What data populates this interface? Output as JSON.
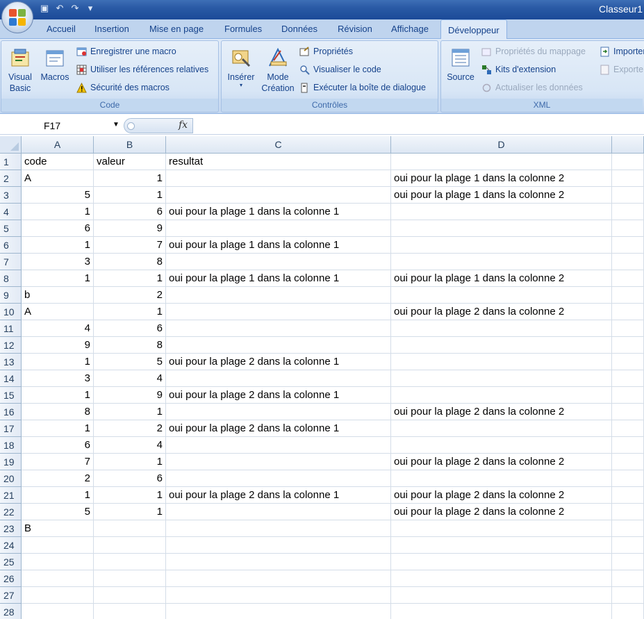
{
  "window": {
    "title": "Classeur1"
  },
  "tabs": [
    "Accueil",
    "Insertion",
    "Mise en page",
    "Formules",
    "Données",
    "Révision",
    "Affichage",
    "Développeur"
  ],
  "active_tab": "Développeur",
  "ribbon": {
    "code": {
      "label": "Code",
      "visual_basic": "Visual\nBasic",
      "macros": "Macros",
      "record_macro": "Enregistrer une macro",
      "relative_refs": "Utiliser les références relatives",
      "macro_security": "Sécurité des macros"
    },
    "controls": {
      "label": "Contrôles",
      "insert": "Insérer",
      "design_mode": "Mode\nCréation",
      "properties": "Propriétés",
      "view_code": "Visualiser le code",
      "run_dialog": "Exécuter la boîte de dialogue"
    },
    "xml": {
      "label": "XML",
      "source": "Source",
      "map_properties": "Propriétés du mappage",
      "expansion_packs": "Kits d'extension",
      "refresh_data": "Actualiser les données",
      "import": "Importer",
      "export": "Exporter"
    }
  },
  "formula_bar": {
    "name_box": "F17",
    "fx": "fx",
    "formula": ""
  },
  "sheet": {
    "columns": [
      "A",
      "B",
      "C",
      "D"
    ],
    "rows": [
      {
        "n": "1",
        "a": "code",
        "b": "valeur",
        "c": "resultat",
        "d": ""
      },
      {
        "n": "2",
        "a": "A",
        "b": "1",
        "c": "",
        "d": "oui pour la plage 1 dans la colonne 2"
      },
      {
        "n": "3",
        "a": "5",
        "b": "1",
        "c": "",
        "d": "oui pour la plage 1 dans la colonne 2"
      },
      {
        "n": "4",
        "a": "1",
        "b": "6",
        "c": "oui pour la plage 1 dans la colonne 1",
        "d": ""
      },
      {
        "n": "5",
        "a": "6",
        "b": "9",
        "c": "",
        "d": ""
      },
      {
        "n": "6",
        "a": "1",
        "b": "7",
        "c": "oui pour la plage 1 dans la colonne 1",
        "d": ""
      },
      {
        "n": "7",
        "a": "3",
        "b": "8",
        "c": "",
        "d": ""
      },
      {
        "n": "8",
        "a": "1",
        "b": "1",
        "c": "oui pour la plage 1 dans la colonne 1",
        "d": "oui pour la plage 1 dans la colonne 2"
      },
      {
        "n": "9",
        "a": "b",
        "b": "2",
        "c": "",
        "d": ""
      },
      {
        "n": "10",
        "a": "A",
        "b": "1",
        "c": "",
        "d": "oui pour la plage 2 dans la colonne 2"
      },
      {
        "n": "11",
        "a": "4",
        "b": "6",
        "c": "",
        "d": ""
      },
      {
        "n": "12",
        "a": "9",
        "b": "8",
        "c": "",
        "d": ""
      },
      {
        "n": "13",
        "a": "1",
        "b": "5",
        "c": "oui pour la plage 2 dans la colonne 1",
        "d": ""
      },
      {
        "n": "14",
        "a": "3",
        "b": "4",
        "c": "",
        "d": ""
      },
      {
        "n": "15",
        "a": "1",
        "b": "9",
        "c": "oui pour la plage 2 dans la colonne 1",
        "d": ""
      },
      {
        "n": "16",
        "a": "8",
        "b": "1",
        "c": "",
        "d": "oui pour la plage 2 dans la colonne 2"
      },
      {
        "n": "17",
        "a": "1",
        "b": "2",
        "c": "oui pour la plage 2 dans la colonne 1",
        "d": ""
      },
      {
        "n": "18",
        "a": "6",
        "b": "4",
        "c": "",
        "d": ""
      },
      {
        "n": "19",
        "a": "7",
        "b": "1",
        "c": "",
        "d": "oui pour la plage 2 dans la colonne 2"
      },
      {
        "n": "20",
        "a": "2",
        "b": "6",
        "c": "",
        "d": ""
      },
      {
        "n": "21",
        "a": "1",
        "b": "1",
        "c": "oui pour la plage 2 dans la colonne 1",
        "d": "oui pour la plage 2 dans la colonne 2"
      },
      {
        "n": "22",
        "a": "5",
        "b": "1",
        "c": "",
        "d": "oui pour la plage 2 dans la colonne 2"
      },
      {
        "n": "23",
        "a": "B",
        "b": "",
        "c": "",
        "d": ""
      },
      {
        "n": "24",
        "a": "",
        "b": "",
        "c": "",
        "d": ""
      },
      {
        "n": "25",
        "a": "",
        "b": "",
        "c": "",
        "d": ""
      },
      {
        "n": "26",
        "a": "",
        "b": "",
        "c": "",
        "d": ""
      },
      {
        "n": "27",
        "a": "",
        "b": "",
        "c": "",
        "d": ""
      },
      {
        "n": "28",
        "a": "",
        "b": "",
        "c": "",
        "d": ""
      }
    ]
  }
}
